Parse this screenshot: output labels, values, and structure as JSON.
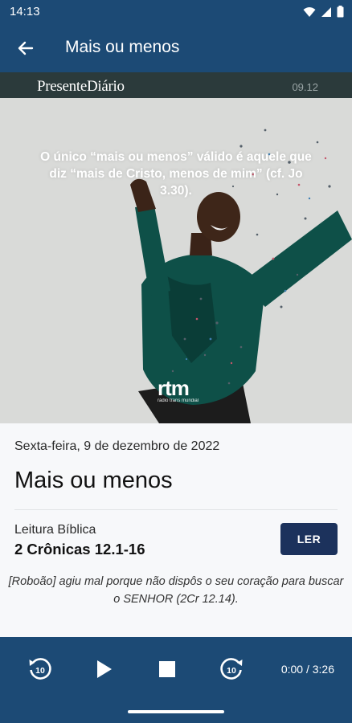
{
  "status_bar": {
    "time": "14:13"
  },
  "app_bar": {
    "title": "Mais ou menos"
  },
  "hero": {
    "brand": "PresenteDiário",
    "date": "09.12",
    "quote": "O único “mais ou menos” válido é aquele que diz “mais de Cristo, menos de mim” (cf. Jo 3.30).",
    "logo": "rtm",
    "logo_sub": "rádio trans mundial"
  },
  "content": {
    "date": "Sexta-feira, 9 de dezembro de 2022",
    "title": "Mais ou menos",
    "reading_label": "Leitura Bíblica",
    "reading_ref": "2 Crônicas 12.1-16",
    "read_button": "LER",
    "verse": "[Roboão] agiu mal porque não dispôs o seu coração para buscar o SENHOR (2Cr 12.14)."
  },
  "player": {
    "rewind_seconds": "10",
    "forward_seconds": "10",
    "time": "0:00 / 3:26",
    "progress": 0
  },
  "colors": {
    "primary": "#1c4a75",
    "button": "#1c325c",
    "content_bg": "#f7f8fa"
  }
}
